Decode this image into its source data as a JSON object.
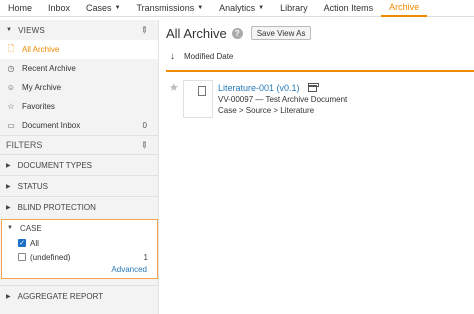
{
  "topnav": {
    "items": [
      {
        "label": "Home",
        "caret": false,
        "active": false
      },
      {
        "label": "Inbox",
        "caret": false,
        "active": false
      },
      {
        "label": "Cases",
        "caret": true,
        "active": false
      },
      {
        "label": "Transmissions",
        "caret": true,
        "active": false
      },
      {
        "label": "Analytics",
        "caret": true,
        "active": false
      },
      {
        "label": "Library",
        "caret": false,
        "active": false
      },
      {
        "label": "Action Items",
        "caret": false,
        "active": false
      },
      {
        "label": "Archive",
        "caret": false,
        "active": true
      }
    ]
  },
  "sidebar": {
    "views_label": "VIEWS",
    "views": [
      {
        "label": "All Archive",
        "icon": "file-icon",
        "active": true,
        "count": ""
      },
      {
        "label": "Recent Archive",
        "icon": "clock-icon",
        "active": false,
        "count": ""
      },
      {
        "label": "My Archive",
        "icon": "user-icon",
        "active": false,
        "count": ""
      },
      {
        "label": "Favorites",
        "icon": "star-icon",
        "active": false,
        "count": ""
      },
      {
        "label": "Document Inbox",
        "icon": "inbox-icon",
        "active": false,
        "count": "0"
      }
    ],
    "filters_label": "FILTERS",
    "filters": [
      "DOCUMENT TYPES",
      "STATUS",
      "BLIND PROTECTION"
    ],
    "case": {
      "label": "CASE",
      "options": [
        {
          "label": "All",
          "checked": true,
          "count": ""
        },
        {
          "label": "(undefined)",
          "checked": false,
          "count": "1"
        }
      ],
      "advanced_label": "Advanced"
    },
    "aggregate_label": "AGGREGATE REPORT"
  },
  "main": {
    "title": "All Archive",
    "help_glyph": "?",
    "save_view_label": "Save View As",
    "sort_label": "Modified Date",
    "documents": [
      {
        "title": "Literature-001 (v0.1)",
        "subtitle": "VV-00097 — Test Archive Document",
        "path": "Case > Source > Literature"
      }
    ]
  },
  "colors": {
    "accent": "#f08a00",
    "link": "#2a7ab8",
    "checkbox": "#1a6fc9"
  }
}
